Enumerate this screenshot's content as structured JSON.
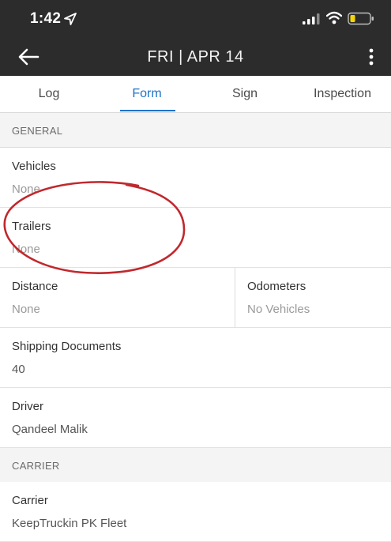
{
  "status_bar": {
    "time": "1:42"
  },
  "app_bar": {
    "title": "FRI | APR 14"
  },
  "tabs": [
    {
      "label": "Log",
      "active": false
    },
    {
      "label": "Form",
      "active": true
    },
    {
      "label": "Sign",
      "active": false
    },
    {
      "label": "Inspection",
      "active": false
    }
  ],
  "sections": {
    "general": "GENERAL",
    "carrier": "CARRIER"
  },
  "fields": {
    "vehicles": {
      "label": "Vehicles",
      "value": "None"
    },
    "trailers": {
      "label": "Trailers",
      "value": "None"
    },
    "distance": {
      "label": "Distance",
      "value": "None"
    },
    "odometers": {
      "label": "Odometers",
      "value": "No Vehicles"
    },
    "shipping_documents": {
      "label": "Shipping Documents",
      "value": "40"
    },
    "driver": {
      "label": "Driver",
      "value": "Qandeel Malik"
    },
    "carrier": {
      "label": "Carrier",
      "value": "KeepTruckin PK Fleet"
    }
  },
  "colors": {
    "header_bg": "#2c2c2c",
    "accent": "#1e73c8",
    "annotation": "#c0282d",
    "battery_low": "#f5d60a"
  }
}
